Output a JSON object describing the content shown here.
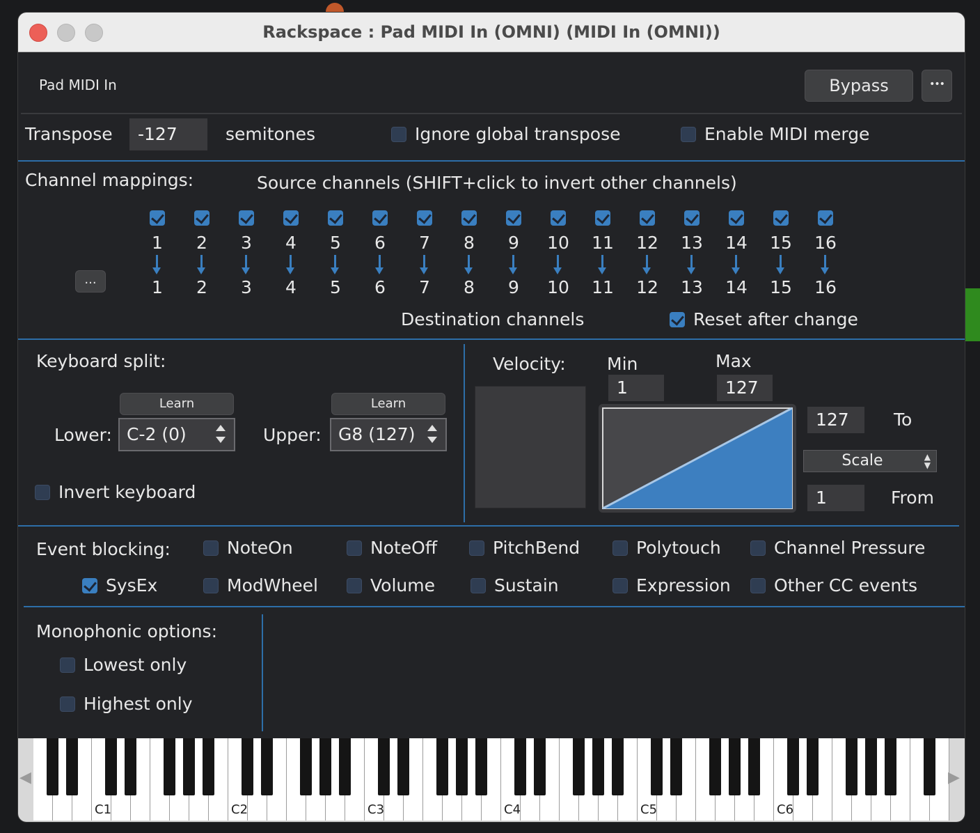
{
  "window": {
    "title": "Rackspace : Pad MIDI In (OMNI) (MIDI In (OMNI))"
  },
  "header": {
    "plugin_name": "Pad MIDI In",
    "bypass_label": "Bypass",
    "more_label": "•••"
  },
  "transpose": {
    "label": "Transpose",
    "value": "-127",
    "unit": "semitones",
    "ignore_global_label": "Ignore global transpose",
    "ignore_global_checked": false,
    "enable_merge_label": "Enable MIDI merge",
    "enable_merge_checked": false
  },
  "channels": {
    "title": "Channel mappings:",
    "source_label": "Source channels (SHIFT+click to invert other channels)",
    "more_label": "...",
    "source": [
      "1",
      "2",
      "3",
      "4",
      "5",
      "6",
      "7",
      "8",
      "9",
      "10",
      "11",
      "12",
      "13",
      "14",
      "15",
      "16"
    ],
    "destination": [
      "1",
      "2",
      "3",
      "4",
      "5",
      "6",
      "7",
      "8",
      "9",
      "10",
      "11",
      "12",
      "13",
      "14",
      "15",
      "16"
    ],
    "source_checked": [
      true,
      true,
      true,
      true,
      true,
      true,
      true,
      true,
      true,
      true,
      true,
      true,
      true,
      true,
      true,
      true
    ],
    "destination_label": "Destination channels",
    "reset_label": "Reset after change",
    "reset_checked": true
  },
  "split": {
    "title": "Keyboard split:",
    "learn_label": "Learn",
    "lower_label": "Lower:",
    "lower_value": "C-2 (0)",
    "upper_label": "Upper:",
    "upper_value": "G8 (127)",
    "invert_label": "Invert keyboard",
    "invert_checked": false
  },
  "velocity": {
    "title": "Velocity:",
    "min_label": "Min",
    "min_value": "1",
    "max_label": "Max",
    "max_value": "127",
    "to_value": "127",
    "to_label": "To",
    "mode": "Scale",
    "from_value": "1",
    "from_label": "From"
  },
  "blocking": {
    "title": "Event blocking:",
    "items": [
      {
        "label": "NoteOn",
        "checked": false
      },
      {
        "label": "NoteOff",
        "checked": false
      },
      {
        "label": "PitchBend",
        "checked": false
      },
      {
        "label": "Polytouch",
        "checked": false
      },
      {
        "label": "Channel Pressure",
        "checked": false
      },
      {
        "label": "SysEx",
        "checked": true
      },
      {
        "label": "ModWheel",
        "checked": false
      },
      {
        "label": "Volume",
        "checked": false
      },
      {
        "label": "Sustain",
        "checked": false
      },
      {
        "label": "Expression",
        "checked": false
      },
      {
        "label": "Other CC events",
        "checked": false
      }
    ]
  },
  "mono": {
    "title": "Monophonic options:",
    "lowest_label": "Lowest only",
    "lowest_checked": false,
    "highest_label": "Highest only",
    "highest_checked": false
  },
  "keyboard": {
    "left_arrow": "◀",
    "right_arrow": "▶",
    "octave_labels": [
      "C1",
      "C2",
      "C3",
      "C4",
      "C5",
      "C6"
    ]
  },
  "colors": {
    "accent": "#3a7fc0",
    "window_bg": "#222326",
    "titlebar": "#ececec",
    "close": "#ec5f57",
    "inactive": "#c8c8c8"
  }
}
